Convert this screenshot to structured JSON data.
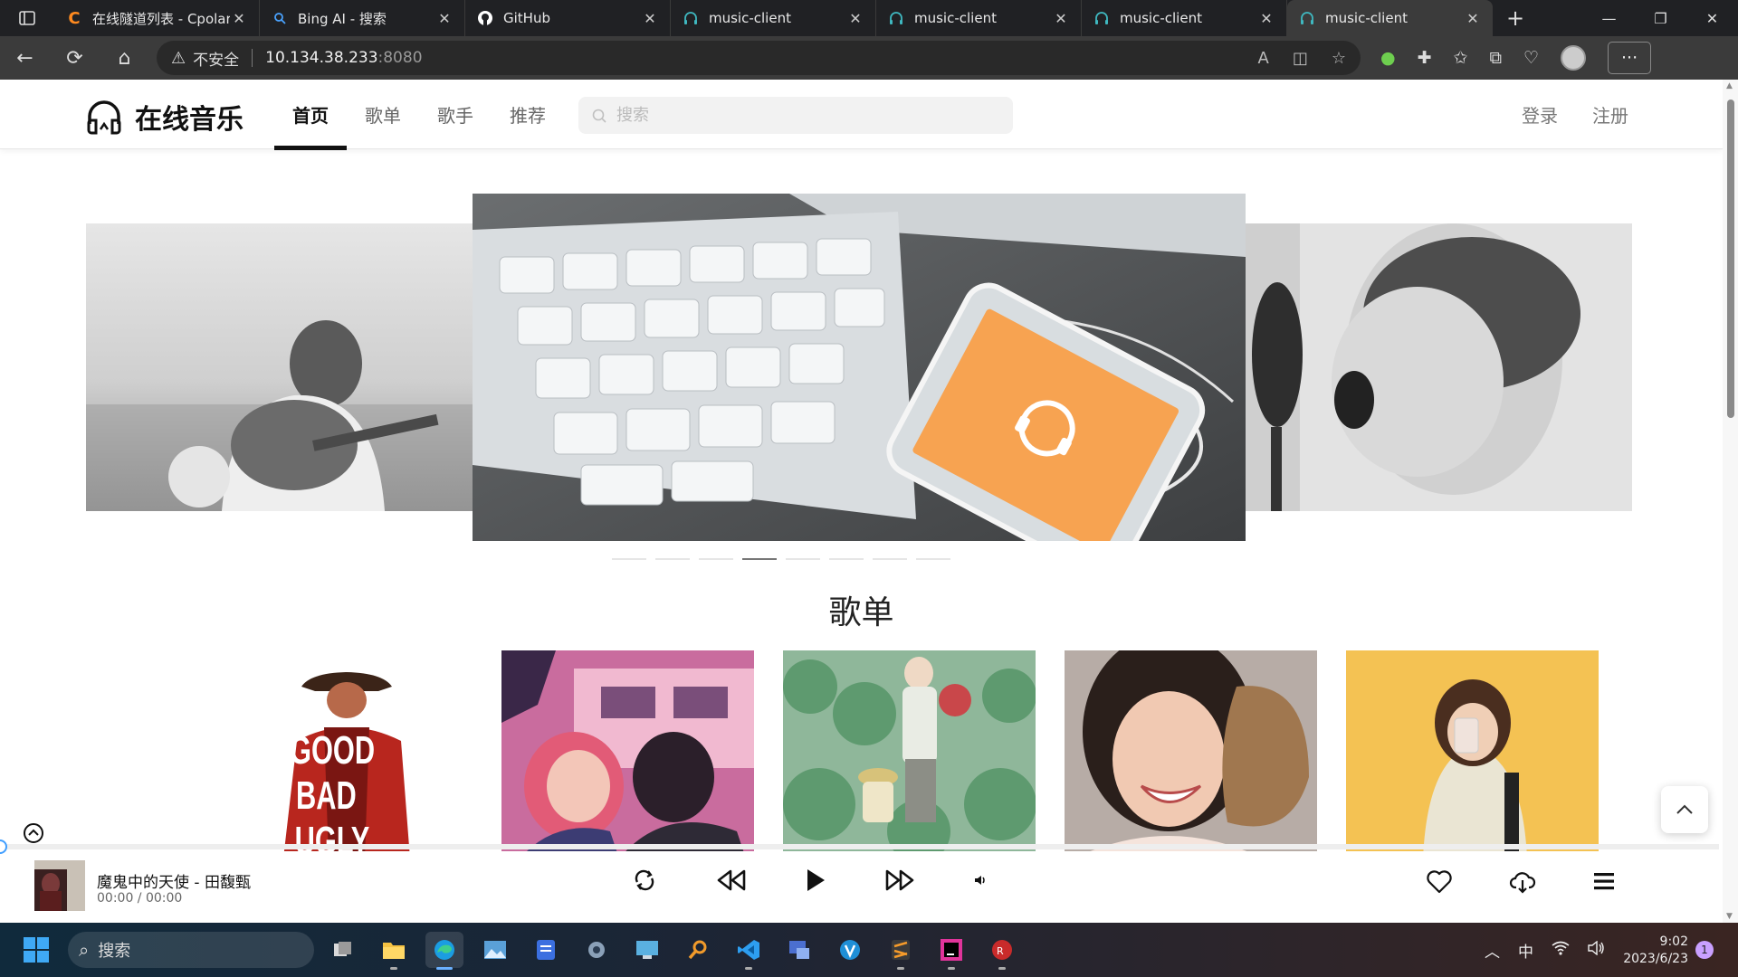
{
  "browser": {
    "tabs": [
      {
        "title": "在线隧道列表 - Cpolar",
        "icon": "cpolar-icon"
      },
      {
        "title": "Bing AI - 搜索",
        "icon": "bing-search-icon"
      },
      {
        "title": "GitHub",
        "icon": "github-icon"
      },
      {
        "title": "music-client",
        "icon": "headphones-icon"
      },
      {
        "title": "music-client",
        "icon": "headphones-icon"
      },
      {
        "title": "music-client",
        "icon": "headphones-icon"
      },
      {
        "title": "music-client",
        "icon": "headphones-icon",
        "active": true
      }
    ],
    "security_label": "不安全",
    "url_host": "10.134.38.233",
    "url_port": ":8080"
  },
  "site": {
    "name": "在线音乐",
    "nav": [
      "首页",
      "歌单",
      "歌手",
      "推荐"
    ],
    "active_nav": "首页",
    "search_placeholder": "搜索",
    "login": "登录",
    "register": "注册"
  },
  "carousel": {
    "dot_count": 8,
    "active_dot_index": 3
  },
  "section": {
    "title": "歌单"
  },
  "player": {
    "song": "魔鬼中的天使 - 田馥甄",
    "time": "00:00 / 00:00"
  },
  "taskbar": {
    "search_placeholder": "搜索",
    "ime": "中",
    "time": "9:02",
    "date": "2023/6/23",
    "notification_count": "1"
  },
  "colors": {
    "accent": "#409eff",
    "tabbar": "#202124",
    "toolbar": "#3b3b3b"
  }
}
